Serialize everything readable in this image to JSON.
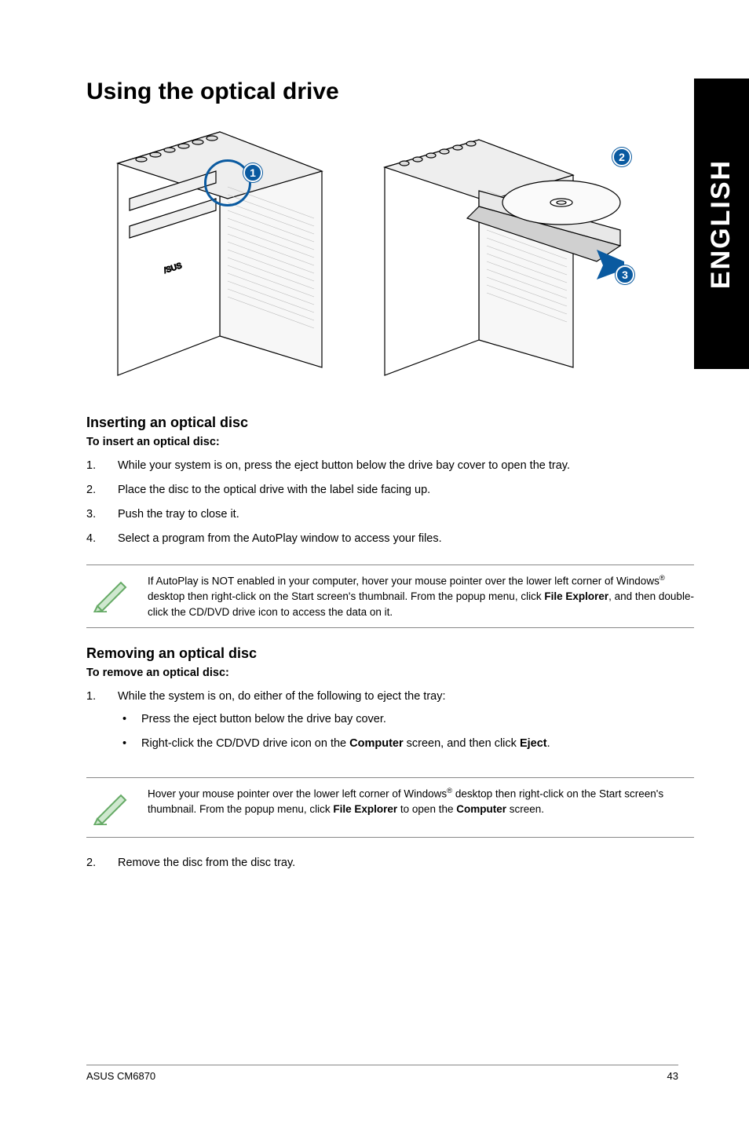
{
  "sidetab": "ENGLISH",
  "title": "Using the optical drive",
  "markers": {
    "m1": "1",
    "m2": "2",
    "m3": "3"
  },
  "insert": {
    "heading": "Inserting an optical disc",
    "lead": "To insert an optical disc:",
    "steps": [
      {
        "n": "1.",
        "t": "While your system is on, press the eject button below the drive bay cover to open the tray."
      },
      {
        "n": "2.",
        "t": "Place the disc to the optical drive with the label side facing up."
      },
      {
        "n": "3.",
        "t": "Push the tray to close it."
      },
      {
        "n": "4.",
        "t": "Select a program from the AutoPlay window to access your files."
      }
    ],
    "note_pre": "If AutoPlay is NOT enabled in your computer, hover your mouse pointer over the lower left corner of Windows",
    "note_reg": "®",
    "note_mid": " desktop then right-click on the Start screen's thumbnail. From the popup menu, click ",
    "note_bold": "File Explorer",
    "note_post": ", and then double-click the CD/DVD drive icon to access the data on it."
  },
  "remove": {
    "heading": "Removing an optical disc",
    "lead": "To remove an optical disc:",
    "step1_n": "1.",
    "step1_t": "While the system is on, do either of the following to eject the tray:",
    "bullet1": "Press the eject button below the drive bay cover.",
    "bullet2_pre": "Right-click the CD/DVD drive icon on the ",
    "bullet2_b1": "Computer",
    "bullet2_mid": " screen, and then click ",
    "bullet2_b2": "Eject",
    "bullet2_post": ".",
    "note_pre": "Hover your mouse pointer over the lower left corner of Windows",
    "note_reg": "®",
    "note_mid": " desktop then right-click on the Start screen's thumbnail. From the popup menu, click ",
    "note_bold": "File Explorer",
    "note_mid2": " to open the ",
    "note_bold2": "Computer",
    "note_post": " screen.",
    "step2_n": "2.",
    "step2_t": "Remove the disc from the disc tray."
  },
  "footer": {
    "left": "ASUS CM6870",
    "right": "43"
  }
}
